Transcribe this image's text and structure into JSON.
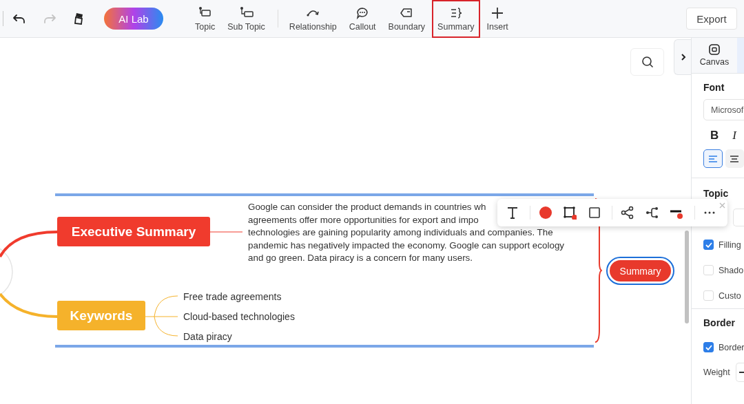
{
  "toolbar": {
    "quick_actions": [
      {
        "kind": "undo",
        "disabled": false
      },
      {
        "kind": "redo",
        "disabled": true
      },
      {
        "kind": "painter",
        "disabled": false
      }
    ],
    "ai_button": "AI Lab",
    "tools": [
      {
        "label": "Topic",
        "kind": "topic",
        "selected": false
      },
      {
        "label": "Sub Topic",
        "kind": "subtopic",
        "selected": false
      },
      {
        "label": "Relationship",
        "kind": "relationship",
        "selected": false
      },
      {
        "label": "Callout",
        "kind": "callout",
        "selected": false
      },
      {
        "label": "Boundary",
        "kind": "boundary",
        "selected": false
      },
      {
        "label": "Summary",
        "kind": "summary",
        "selected": true
      },
      {
        "label": "Insert",
        "kind": "insert",
        "selected": false
      }
    ],
    "export": "Export"
  },
  "canvas": {
    "topics": [
      {
        "label": "Executive Summary",
        "color": "#f03b2d",
        "note": [
          "Google can consider the product demands in countries wh",
          "agreements offer more opportunities for export and impo",
          "technologies are gaining popularity among individuals and companies. The",
          "pandemic has negatively impacted the economy. Google can support ecology",
          "and go green. Data piracy is a concern for many users."
        ]
      },
      {
        "label": "Keywords",
        "color": "#f5b22b",
        "subtopics": [
          "Free trade agreements",
          "Cloud-based technologies",
          "Data piracy"
        ]
      }
    ],
    "summary": {
      "label": "Summary",
      "selected": true
    }
  },
  "floating_toolbar": {
    "tools": [
      {
        "kind": "text"
      },
      {
        "kind": "fill"
      },
      {
        "kind": "border"
      },
      {
        "kind": "shape"
      },
      {
        "kind": "share"
      },
      {
        "kind": "branch"
      },
      {
        "kind": "line"
      },
      {
        "kind": "more"
      }
    ]
  },
  "panel": {
    "tab": "Canvas",
    "font": {
      "heading": "Font",
      "family": "Microsof",
      "styles": [
        {
          "label": "B",
          "kind": "bold"
        },
        {
          "label": "I",
          "kind": "italic"
        }
      ],
      "align": [
        {
          "kind": "left",
          "selected": true
        },
        {
          "kind": "center",
          "selected": false
        }
      ]
    },
    "topic": {
      "heading": "Topic",
      "options": [
        {
          "label": "Filling",
          "checked": true
        },
        {
          "label": "Shado",
          "checked": false
        },
        {
          "label": "Custo",
          "checked": false
        }
      ]
    },
    "border": {
      "heading": "Border",
      "options": [
        {
          "label": "Border",
          "checked": true
        }
      ],
      "weight_label": "Weight"
    }
  }
}
